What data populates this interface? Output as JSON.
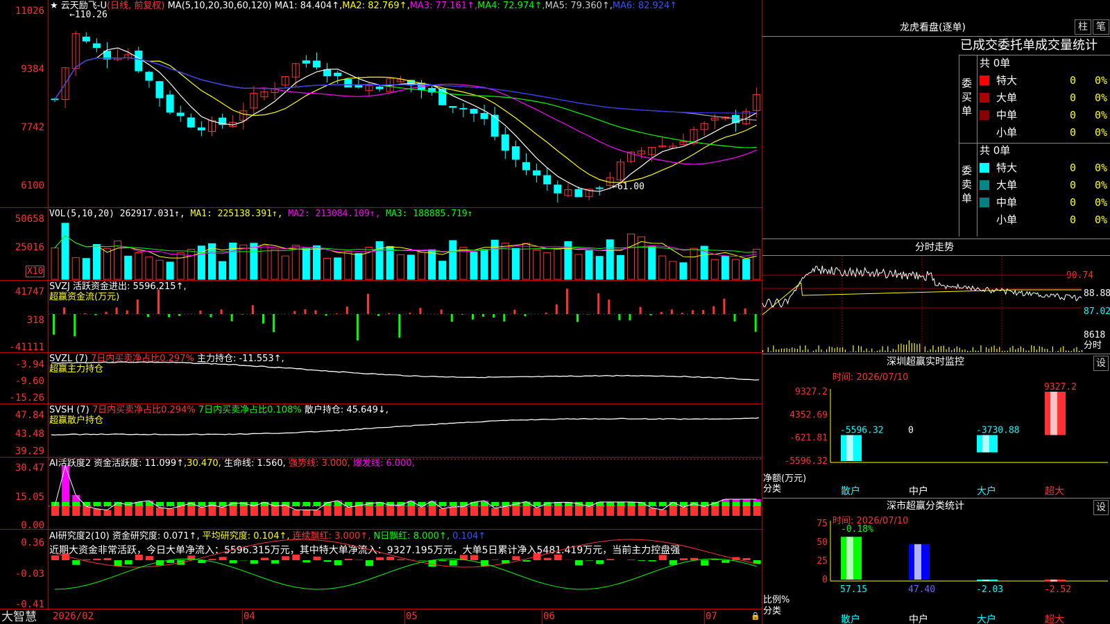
{
  "colors": {
    "up": "#ff3333",
    "down": "#00ffff",
    "grid": "#c00000",
    "axis": "#ff3030",
    "white": "#ffffff",
    "yellow": "#ffff00",
    "magenta": "#ff00ff",
    "green": "#00ff00",
    "blue": "#3333ff",
    "gray": "#aaaaaa"
  },
  "kline": {
    "title": "云天励飞-U",
    "period": "(日线, 前复权)",
    "ma_label": "MA(5,10,20,30,60,120)",
    "ma1": "MA1: 84.404↑,",
    "ma2": "MA2: 82.769↑,",
    "ma3": "MA3: 77.161↑,",
    "ma4": "MA4: 72.974↑,",
    "ma5": "MA5: 79.360↑,",
    "ma6": "MA6: 82.924↑",
    "axis": [
      "11026",
      "9384",
      "7742",
      "6100"
    ],
    "high_mark": "110.26",
    "low_mark": "61.00"
  },
  "vol": {
    "label": "VOL(5,10,20)",
    "value": "262917.031↑,",
    "ma1": "MA1: 225138.391↑,",
    "ma2": "MA2: 213084.109↑,",
    "ma3": "MA3: 188885.719↑",
    "axis": [
      "50658",
      "25016"
    ],
    "unit": "X10"
  },
  "svzj": {
    "label": "SVZJ",
    "title": "活跃资金进出: 5596.215↑,",
    "sub": "超赢资金流(万元)",
    "axis": [
      "41747",
      "318",
      "-41111"
    ]
  },
  "svzl": {
    "label": "SVZL (7)",
    "seg1": "7日内买卖净占比0.297%",
    "seg2": "主力持仓: -11.553↑,",
    "sub": "超赢主力持仓",
    "axis": [
      "-3.94",
      "-9.60",
      "-15.26"
    ]
  },
  "svsh": {
    "label": "SVSH (7)",
    "seg1": "7日内买卖净占比0.294%",
    "seg2": "7日内买卖净占比0.108%",
    "seg3": "散户持仓: 45.649↓,",
    "sub": "超赢散户持仓",
    "axis": [
      "47.84",
      "43.48",
      "39.29"
    ]
  },
  "ai1": {
    "label": "AI活跃度2",
    "seg1": "资金活跃度: 11.099↑,",
    "seg2": "30.470,",
    "seg3": "生命线: 1.560,",
    "seg4": "强势线: 3.000,",
    "seg5": "爆发线: 6.000,",
    "axis": [
      "30.47",
      "15.05",
      "0.00"
    ]
  },
  "ai2": {
    "label": "AI研究度2(10)",
    "seg1": "资金研究度: 0.071↑,",
    "seg2": "平均研究度: 0.104↑,",
    "seg3": "连续飘红: 3.000↑,",
    "seg4": "N日飘红: 8.000↑,",
    "seg5": "0.104↑",
    "comment": "近期大资金非常活跃，今日大单净流入：5596.315万元，其中特大单净流入：9327.195万元，大单5日累计净入5481.419万元，当前主力控盘强",
    "axis": [
      "0.36",
      "-0.03",
      "-0.41"
    ]
  },
  "xaxis": {
    "labels": [
      "2026/02",
      "04",
      "05",
      "06",
      "07"
    ]
  },
  "brand": "大智慧",
  "dragon": {
    "title": "龙虎看盘(逐单)",
    "btn_zhu": "柱",
    "btn_bi": "笔",
    "header": "已成交委托单成交量统计",
    "buy_label": "委买单",
    "sell_label": "委卖单",
    "total": "共 0单",
    "rows": [
      {
        "name": "特大",
        "v": "0",
        "p": "0%"
      },
      {
        "name": "大单",
        "v": "0",
        "p": "0%"
      },
      {
        "name": "中单",
        "v": "0",
        "p": "0%"
      },
      {
        "name": "小单",
        "v": "0",
        "p": "0%"
      }
    ]
  },
  "intraday": {
    "title": "分时走势",
    "axis": [
      "90.74",
      "88.88",
      "87.02"
    ],
    "vol": "8618",
    "unit": "分时"
  },
  "sz": {
    "title": "深圳超赢实时监控",
    "btn": "设",
    "time": "时间: 2026/07/10",
    "axis": [
      "9327.2",
      "4352.69",
      "-621.81",
      "-5596.32"
    ],
    "ylabel": "净额(万元)",
    "xlabel": "分类",
    "bars": [
      {
        "name": "散户",
        "value": -5596.32,
        "label": "-5596.32"
      },
      {
        "name": "中户",
        "value": 0,
        "label": "0"
      },
      {
        "name": "大户",
        "value": -3730.88,
        "label": "-3730.88"
      },
      {
        "name": "超大",
        "value": 9327.2,
        "label": "9327.2"
      }
    ]
  },
  "ss": {
    "title": "深市超赢分类统计",
    "btn": "设",
    "time": "时间: 2026/07/10",
    "axis": [
      "75",
      "50",
      "25",
      "0"
    ],
    "ylabel": "比例%",
    "xlabel": "分类",
    "top_label": "-0.18%",
    "bars": [
      {
        "name": "散户",
        "value": 57.15,
        "label": "57.15"
      },
      {
        "name": "中户",
        "value": 47.4,
        "label": "47.40"
      },
      {
        "name": "大户",
        "value": -2.03,
        "label": "-2.03"
      },
      {
        "name": "超大",
        "value": -2.52,
        "label": "-2.52"
      }
    ]
  }
}
